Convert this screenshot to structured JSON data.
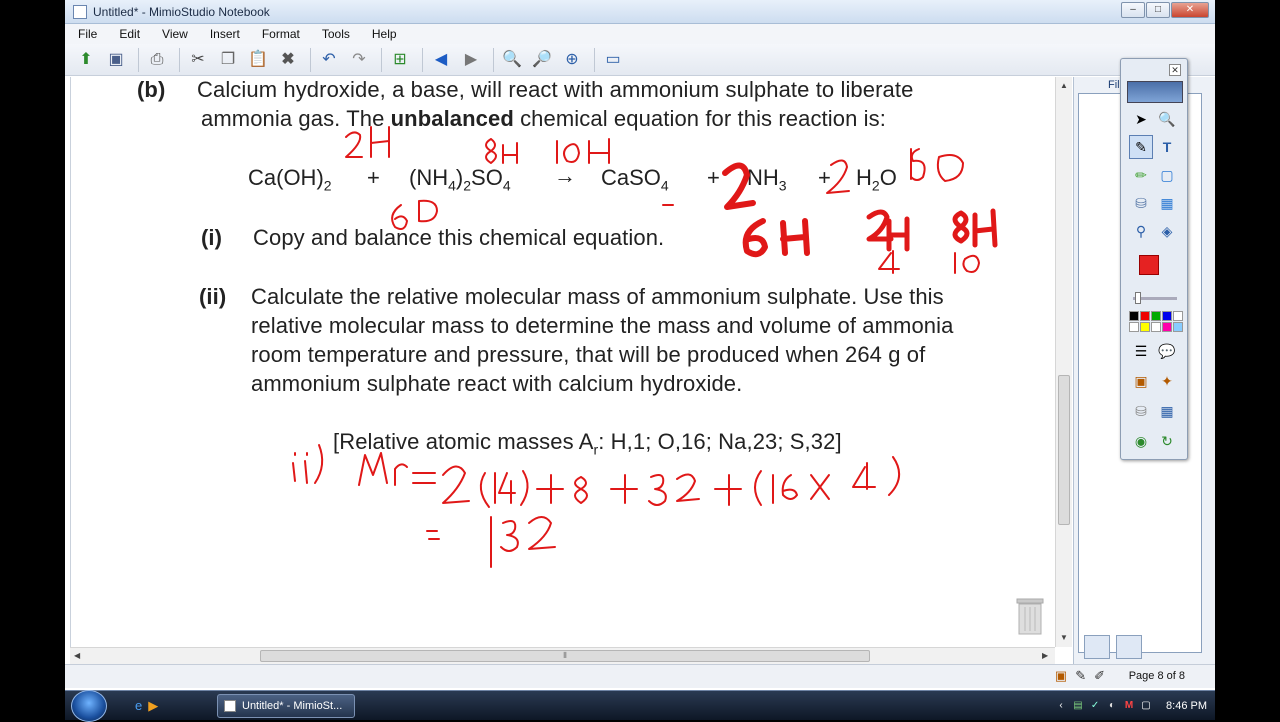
{
  "window": {
    "title": "Untitled* - MimioStudio Notebook",
    "buttons": {
      "minimize": "–",
      "maximize": "□",
      "close": "✕"
    }
  },
  "menu": [
    "File",
    "Edit",
    "View",
    "Insert",
    "Format",
    "Tools",
    "Help"
  ],
  "document": {
    "b_label": "(b)",
    "b_line1": "Calcium hydroxide, a base, will react with ammonium sulphate to liberate",
    "b_line2_pre": "ammonia gas. The ",
    "b_line2_bold": "unbalanced",
    "b_line2_post": " chemical equation for this reaction is:",
    "equation": {
      "ca_oh2": "Ca(OH)",
      "ca_oh2_sub": "2",
      "plus1": "+",
      "nh4_a": "(NH",
      "nh4_sub": "4",
      "nh4_b": ")",
      "nh4_sub2": "2",
      "so4": "SO",
      "so4_sub": "4",
      "arrow": "→",
      "caso": "CaSO",
      "caso_sub": "4",
      "plus2": "+",
      "nh3": "NH",
      "nh3_sub": "3",
      "plus3": "+",
      "h2o_a": "H",
      "h2o_sub": "2",
      "h2o_b": "O"
    },
    "i_label": "(i)",
    "i_text": "Copy and balance this chemical equation.",
    "ii_label": "(ii)",
    "ii_line1": "Calculate the relative molecular mass of ammonium sulphate. Use this",
    "ii_line2": "relative molecular mass to determine the mass and volume of ammonia",
    "ii_line3": "room temperature and pressure, that will be produced when 264 g of",
    "ii_line4": "ammonium sulphate react with calcium hydroxide.",
    "atomic_masses_pre": "[Relative atomic masses A",
    "atomic_masses_sub": "r",
    "atomic_masses_post": ": H,1; O,16; Na,23; S,32]"
  },
  "ink_color": "#e01818",
  "right_panel": {
    "tab": "Fil"
  },
  "status": {
    "page": "Page 8 of 8"
  },
  "taskbar": {
    "task": "Untitled* - MimioSt...",
    "clock": "8:46 PM"
  }
}
